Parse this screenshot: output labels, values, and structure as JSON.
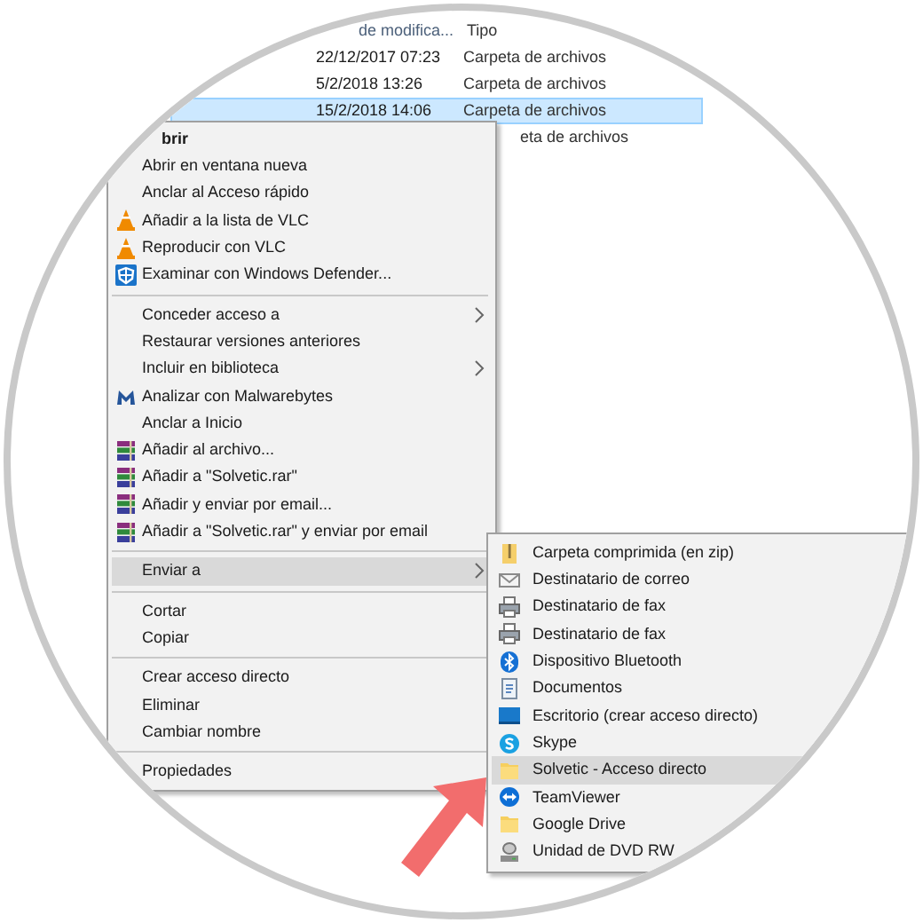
{
  "file_list": {
    "columns": [
      "de modifica...",
      "Tipo"
    ],
    "rows": [
      {
        "date": "22/12/2017 07:23",
        "type": "Carpeta de archivos",
        "selected": false
      },
      {
        "date": "5/2/2018 13:26",
        "type": "Carpeta de archivos",
        "selected": false
      },
      {
        "date": "15/2/2018 14:06",
        "type": "Carpeta de archivos",
        "selected": true
      },
      {
        "type": "eta de archivos",
        "selected": false
      }
    ]
  },
  "context_menu": {
    "groups": [
      [
        {
          "label": "brir",
          "kind": "default",
          "has_submenu": false,
          "selected": false
        },
        {
          "label": "Abrir en ventana nueva",
          "kind": "plain",
          "has_submenu": false,
          "selected": false
        },
        {
          "label": "Anclar al Acceso rápido",
          "kind": "plain",
          "has_submenu": false,
          "selected": false
        },
        {
          "label": "Añadir a la lista de VLC",
          "kind": "vlc",
          "has_submenu": false,
          "selected": false
        },
        {
          "label": "Reproducir con VLC",
          "kind": "vlc",
          "has_submenu": false,
          "selected": false
        },
        {
          "label": "Examinar con Windows Defender...",
          "kind": "shield",
          "has_submenu": false,
          "selected": false
        }
      ],
      [
        {
          "label": "Conceder acceso a",
          "kind": "plain",
          "has_submenu": true,
          "selected": false
        },
        {
          "label": "Restaurar versiones anteriores",
          "kind": "plain",
          "has_submenu": false,
          "selected": false
        },
        {
          "label": "Incluir en biblioteca",
          "kind": "plain",
          "has_submenu": true,
          "selected": false
        },
        {
          "label": "Analizar con Malwarebytes",
          "kind": "scanner",
          "has_submenu": false,
          "selected": false
        },
        {
          "label": "Anclar a Inicio",
          "kind": "plain",
          "has_submenu": false,
          "selected": false
        },
        {
          "label": "Añadir al archivo...",
          "kind": "archive",
          "has_submenu": false,
          "selected": false
        },
        {
          "label": "Añadir a \"Solvetic.rar\"",
          "kind": "archive",
          "has_submenu": false,
          "selected": false
        },
        {
          "label": "Añadir y enviar por email...",
          "kind": "archive",
          "has_submenu": false,
          "selected": false
        },
        {
          "label": "Añadir a \"Solvetic.rar\" y enviar por email",
          "kind": "archive",
          "has_submenu": false,
          "selected": false
        }
      ],
      [
        {
          "label": "Enviar a",
          "kind": "plain",
          "has_submenu": true,
          "selected": true
        }
      ],
      [
        {
          "label": "Cortar",
          "kind": "plain",
          "has_submenu": false,
          "selected": false
        },
        {
          "label": "Copiar",
          "kind": "plain",
          "has_submenu": false,
          "selected": false
        }
      ],
      [
        {
          "label": "Crear acceso directo",
          "kind": "plain",
          "has_submenu": false,
          "selected": false
        },
        {
          "label": "Eliminar",
          "kind": "plain",
          "has_submenu": false,
          "selected": false
        },
        {
          "label": "Cambiar nombre",
          "kind": "plain",
          "has_submenu": false,
          "selected": false
        }
      ],
      [
        {
          "label": "Propiedades",
          "kind": "plain",
          "has_submenu": false,
          "selected": false
        }
      ]
    ]
  },
  "send_to_menu": {
    "items": [
      {
        "label": "Carpeta comprimida (en zip)",
        "kind": "zip",
        "selected": false
      },
      {
        "label": "Destinatario de correo",
        "kind": "mail",
        "selected": false
      },
      {
        "label": "Destinatario de fax",
        "kind": "fax",
        "selected": false
      },
      {
        "label": "Destinatario de fax",
        "kind": "fax",
        "selected": false
      },
      {
        "label": "Dispositivo Bluetooth",
        "kind": "bluetooth",
        "selected": false
      },
      {
        "label": "Documentos",
        "kind": "documents",
        "selected": false
      },
      {
        "label": "Escritorio (crear acceso directo)",
        "kind": "desktop",
        "selected": false
      },
      {
        "label": "Skype",
        "kind": "skype",
        "selected": false
      },
      {
        "label": "Solvetic - Acceso directo",
        "kind": "folder",
        "selected": true
      },
      {
        "label": "TeamViewer",
        "kind": "teamviewer",
        "selected": false
      },
      {
        "label": "Google Drive",
        "kind": "folder",
        "selected": false
      },
      {
        "label": "Unidad de DVD RW",
        "kind": "drive",
        "selected": false
      }
    ]
  }
}
